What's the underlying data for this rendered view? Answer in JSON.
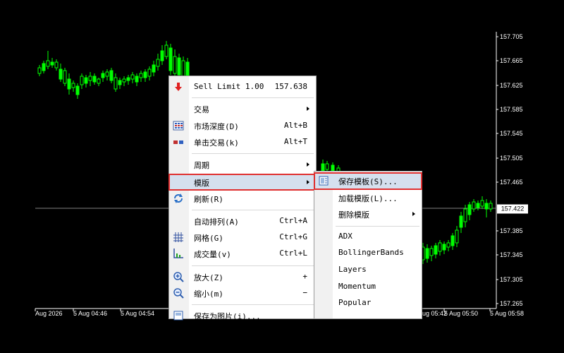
{
  "chart": {
    "bull_color": "#00ff00",
    "background": "#000000",
    "price_axis": [
      "157.705",
      "157.665",
      "157.625",
      "157.585",
      "157.545",
      "157.505",
      "157.465",
      "157.422",
      "157.385",
      "157.345",
      "157.305",
      "157.265"
    ],
    "current_price": "157.422",
    "time_axis": [
      "Aug 2026",
      "5 Aug 04:46",
      "5 Aug 04:54",
      "5 Aug 05:42",
      "5 Aug 05:50",
      "5 Aug 05:58"
    ]
  },
  "context_menu": {
    "items": [
      {
        "label": "Sell Limit 1.00",
        "shortcut": "157.638",
        "icon": "sell-limit-icon"
      },
      {
        "label": "交易",
        "submenu": true
      },
      {
        "label": "市场深度(D)",
        "shortcut": "Alt+B",
        "icon": "depth-of-market-icon"
      },
      {
        "label": "单击交易(k)",
        "shortcut": "Alt+T",
        "icon": "one-click-trading-icon"
      },
      {
        "label": "周期",
        "submenu": true
      },
      {
        "label": "模版",
        "submenu": true,
        "highlighted": true
      },
      {
        "label": "刷新(R)",
        "icon": "refresh-icon"
      },
      {
        "label": "自动排列(A)",
        "shortcut": "Ctrl+A"
      },
      {
        "label": "网格(G)",
        "shortcut": "Ctrl+G",
        "icon": "grid-icon"
      },
      {
        "label": "成交量(v)",
        "shortcut": "Ctrl+L",
        "icon": "volume-icon"
      },
      {
        "label": "放大(Z)",
        "shortcut": "+",
        "icon": "zoom-in-icon"
      },
      {
        "label": "缩小(m)",
        "shortcut": "−",
        "icon": "zoom-out-icon"
      },
      {
        "label": "保存为图片(i)..."
      }
    ]
  },
  "template_submenu": {
    "items": [
      {
        "label": "保存模板(S)...",
        "highlighted": true,
        "icon": "save-template-icon"
      },
      {
        "label": "加载模版(L)..."
      },
      {
        "label": "删除模版",
        "submenu": true
      },
      {
        "label": "ADX"
      },
      {
        "label": "BollingerBands"
      },
      {
        "label": "Layers"
      },
      {
        "label": "Momentum"
      },
      {
        "label": "Popular"
      }
    ]
  }
}
